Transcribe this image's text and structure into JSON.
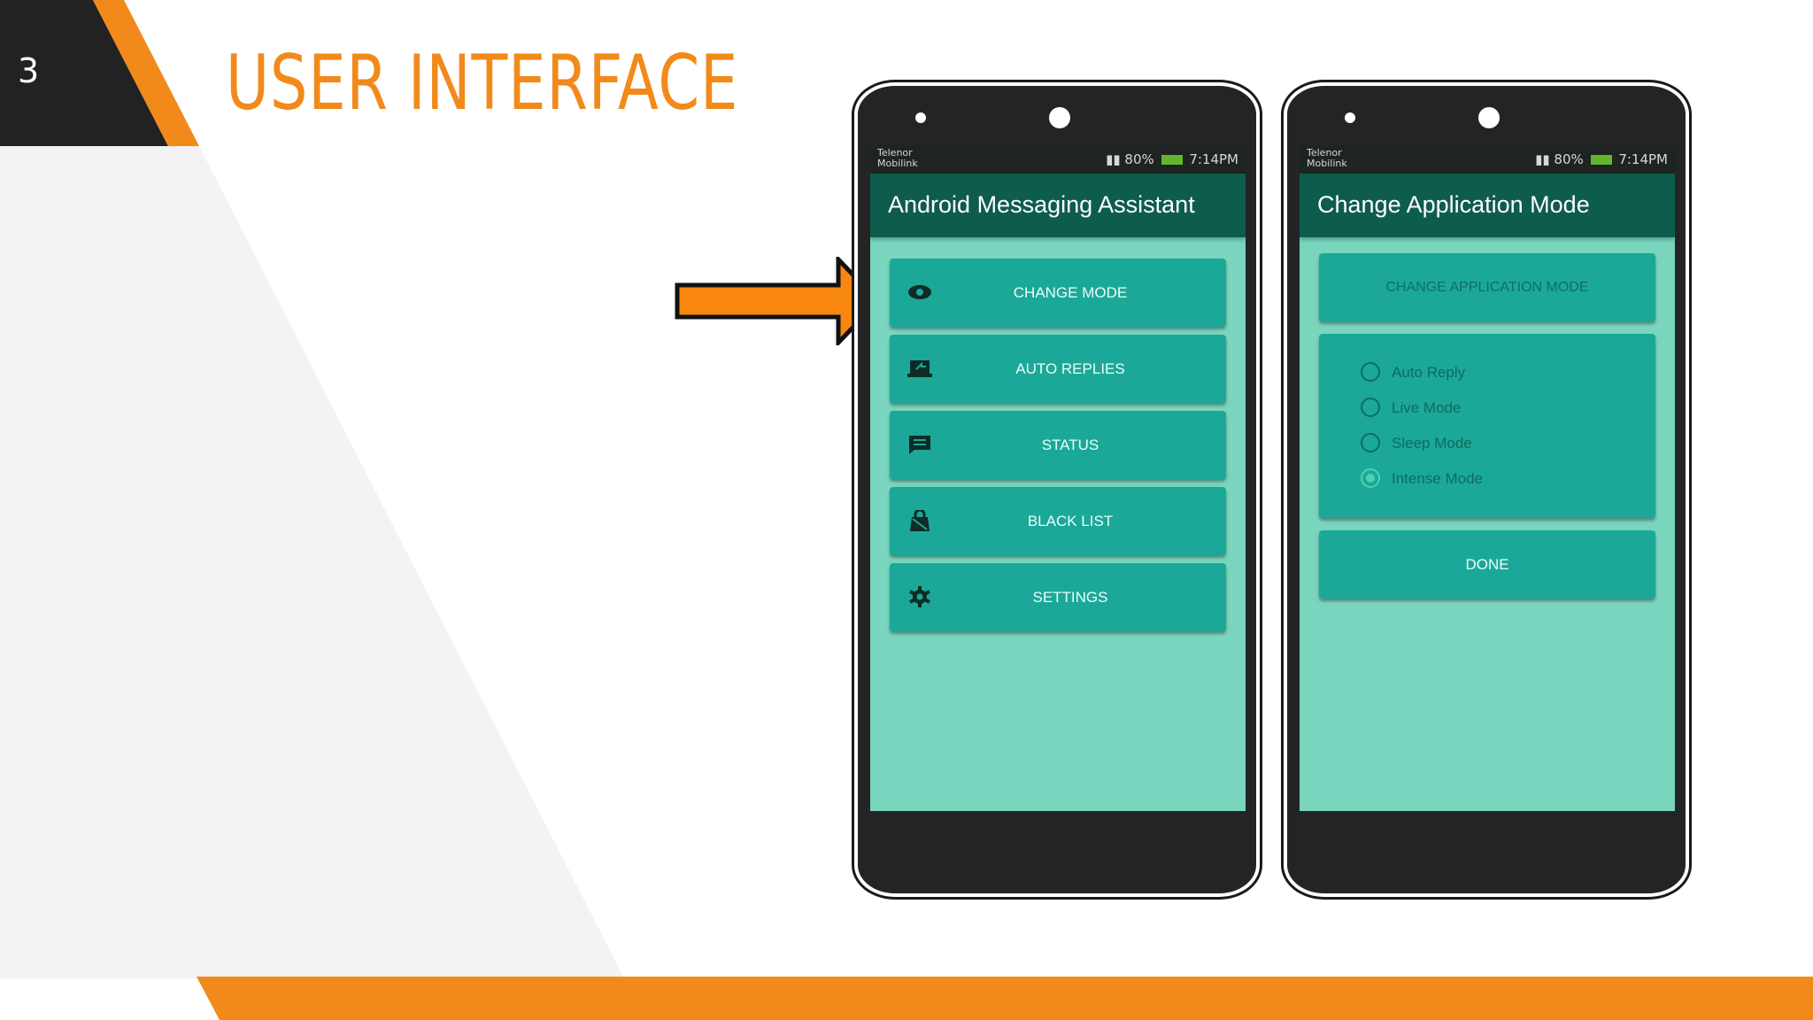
{
  "slide": {
    "number": "3",
    "title": "USER INTERFACE",
    "colors": {
      "accent": "#f28a1b",
      "dark": "#222222",
      "screen_bg": "#79d5be",
      "appbar": "#0e5c4c",
      "button": "#1ba898"
    }
  },
  "left_phone": {
    "status": {
      "carrier": "Telenor\nMobilink",
      "right": "80%",
      "time": "7:14PM"
    },
    "appbar_title": "Android Messaging Assistant",
    "buttons": [
      {
        "label": "CHANGE MODE",
        "icon": "eye-icon"
      },
      {
        "label": "AUTO REPLIES",
        "icon": "laptop-reply-icon"
      },
      {
        "label": "STATUS",
        "icon": "chat-icon"
      },
      {
        "label": "BLACK LIST",
        "icon": "lock-bag-icon"
      },
      {
        "label": "SETTINGS",
        "icon": "gear-icon"
      }
    ]
  },
  "right_phone": {
    "status": {
      "carrier": "Telenor\nMobilink",
      "right": "80%",
      "time": "7:14PM"
    },
    "appbar_title": "Change Application Mode",
    "header_button": "CHANGE APPLICATION MODE",
    "options": [
      {
        "label": "Auto Reply",
        "selected": false
      },
      {
        "label": "Live Mode",
        "selected": false
      },
      {
        "label": "Sleep Mode",
        "selected": false
      },
      {
        "label": "Intense Mode",
        "selected": true
      }
    ],
    "done_label": "DONE"
  }
}
